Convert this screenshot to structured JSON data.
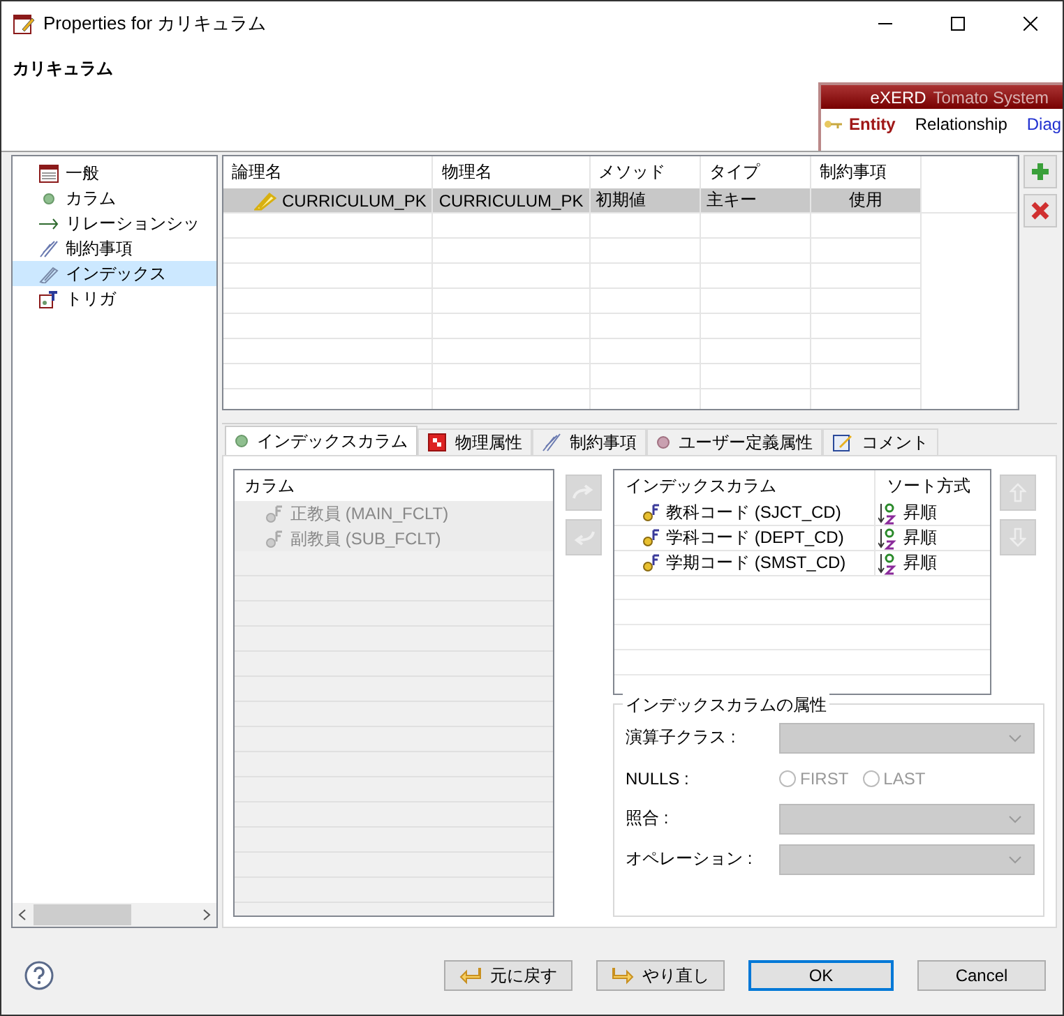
{
  "window": {
    "title": "Properties for カリキュラム"
  },
  "header": {
    "title": "カリキュラム"
  },
  "banner": {
    "brand": "eXERD",
    "product": "Tomato System",
    "links": [
      {
        "label": "Entity",
        "selected": true
      },
      {
        "label": "Relationship",
        "selected": false
      },
      {
        "label": "Diag",
        "selected": false
      }
    ]
  },
  "tree": {
    "items": [
      {
        "label": "一般",
        "selected": false
      },
      {
        "label": "カラム",
        "selected": false
      },
      {
        "label": "リレーションシッ",
        "selected": false
      },
      {
        "label": "制約事項",
        "selected": false
      },
      {
        "label": "インデックス",
        "selected": true
      },
      {
        "label": "トリガ",
        "selected": false
      }
    ]
  },
  "index_table": {
    "columns": [
      "論理名",
      "物理名",
      "メソッド",
      "タイプ",
      "制約事項"
    ],
    "rows": [
      {
        "cells": [
          "CURRICULUM_PK",
          "CURRICULUM_PK",
          "初期値",
          "主キー",
          "使用"
        ],
        "selected": true
      }
    ]
  },
  "tabs": [
    {
      "label": "インデックスカラム",
      "selected": true
    },
    {
      "label": "物理属性",
      "selected": false
    },
    {
      "label": "制約事項",
      "selected": false
    },
    {
      "label": "ユーザー定義属性",
      "selected": false
    },
    {
      "label": "コメント",
      "selected": false
    }
  ],
  "columns_list": {
    "header": "カラム",
    "disabled": true,
    "items": [
      "正教員 (MAIN_FCLT)",
      "副教員 (SUB_FCLT)"
    ]
  },
  "index_columns": {
    "columns": [
      "インデックスカラム",
      "ソート方式"
    ],
    "rows": [
      {
        "name": "教科コード (SJCT_CD)",
        "sort": "昇順"
      },
      {
        "name": "学科コード (DEPT_CD)",
        "sort": "昇順"
      },
      {
        "name": "学期コード (SMST_CD)",
        "sort": "昇順"
      }
    ]
  },
  "attributes": {
    "legend": "インデックスカラムの属性",
    "fields": [
      {
        "kind": "select",
        "label": "演算子クラス :",
        "disabled": true
      },
      {
        "kind": "radio",
        "label": "NULLS :",
        "disabled": true,
        "options": [
          {
            "label": "FIRST",
            "selected": false
          },
          {
            "label": "LAST",
            "selected": false
          }
        ]
      },
      {
        "kind": "select",
        "label": "照合 :",
        "disabled": true
      },
      {
        "kind": "select",
        "label": "オペレーション :",
        "disabled": true
      }
    ]
  },
  "buttons": [
    {
      "label": "元に戻す",
      "kind": "undo"
    },
    {
      "label": "やり直し",
      "kind": "redo"
    },
    {
      "label": "OK",
      "kind": "default"
    },
    {
      "label": "Cancel",
      "kind": "plain"
    }
  ]
}
